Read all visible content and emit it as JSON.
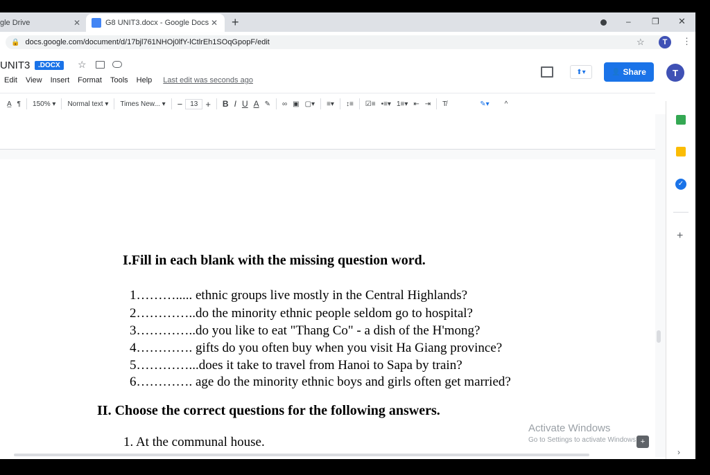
{
  "browser": {
    "tabs": [
      {
        "title": "gle Drive"
      },
      {
        "title": "G8 UNIT3.docx - Google Docs"
      }
    ],
    "new_tab": "+",
    "url": "docs.google.com/document/d/17bjl761NHOj0lfY-lCtlrEh1SOqGpopF/edit",
    "avatar": "T",
    "window_controls": {
      "minimize": "–",
      "restore": "❐",
      "close": "✕"
    }
  },
  "doc": {
    "title": "UNIT3",
    "badge": ".DOCX",
    "menu": [
      "Edit",
      "View",
      "Insert",
      "Format",
      "Tools",
      "Help"
    ],
    "last_edit": "Last edit was seconds ago",
    "share": "Share",
    "avatar": "T"
  },
  "toolbar": {
    "zoom": "150%",
    "style": "Normal text",
    "font": "Times New...",
    "size": "13",
    "bold": "B",
    "italic": "I",
    "underline": "U",
    "text_color": "A"
  },
  "content": {
    "heading1": "I.Fill in each blank with the missing question word.",
    "items": [
      "1………..... ethnic groups live mostly in the Central Highlands?",
      "2…………..do the minority ethnic people seldom go to hospital?",
      "3…………..do you like to eat \"Thang Co\" - a dish of the H'mong?",
      "4…………. gifts do you often buy when you visit Ha Giang province?",
      "5…………...does it take to travel from Hanoi to Sapa by train?",
      "6…………. age do the minority ethnic boys and girls often get married?"
    ],
    "heading2": "II. Choose the correct questions for the following answers.",
    "answer1": "1. At the communal house."
  },
  "watermark": {
    "line1": "Activate Windows",
    "line2": "Go to Settings to activate Windows."
  },
  "colors": {
    "accent": "#1a73e8",
    "docs_blue": "#4285f4"
  }
}
